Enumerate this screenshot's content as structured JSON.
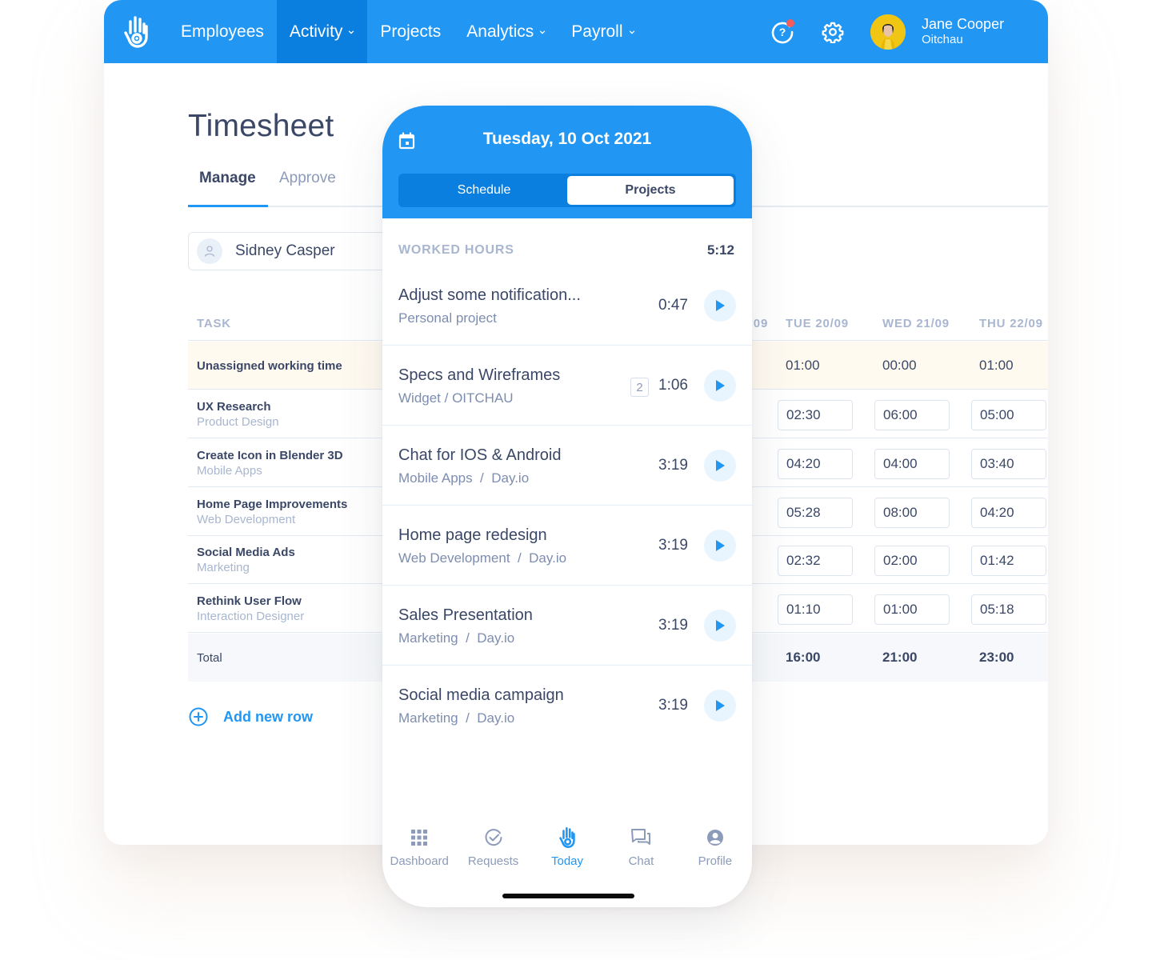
{
  "app": {
    "nav": [
      {
        "label": "Employees",
        "has_dropdown": false,
        "active": false
      },
      {
        "label": "Activity",
        "has_dropdown": true,
        "active": true
      },
      {
        "label": "Projects",
        "has_dropdown": false,
        "active": false
      },
      {
        "label": "Analytics",
        "has_dropdown": true,
        "active": false
      },
      {
        "label": "Payroll",
        "has_dropdown": true,
        "active": false
      }
    ],
    "icons": {
      "logo": "hand-logo-icon",
      "help": "help-icon",
      "settings": "gear-icon"
    },
    "user": {
      "name": "Jane Cooper",
      "org": "Oitchau"
    },
    "colors": {
      "brand": "#2196f3",
      "nav_active": "#0a7fe0",
      "notification": "#f25c5c",
      "text": "#3a4766",
      "muted": "#a8b6cf"
    }
  },
  "timesheet": {
    "title": "Timesheet",
    "tabs": [
      {
        "label": "Manage",
        "active": true
      },
      {
        "label": "Approve",
        "active": false
      }
    ],
    "employee": "Sidney Casper",
    "task_header": "TASK",
    "day_headers": [
      "…09",
      "TUE 20/09",
      "WED 21/09",
      "THU 22/09"
    ],
    "rows": [
      {
        "name": "Unassigned working time",
        "sub": "",
        "values": [
          "01:00",
          "00:00",
          "01:00"
        ]
      },
      {
        "name": "UX Research",
        "sub": "Product Design",
        "values": [
          "02:30",
          "06:00",
          "05:00"
        ]
      },
      {
        "name": "Create Icon in Blender 3D",
        "sub": "Mobile Apps",
        "values": [
          "04:20",
          "04:00",
          "03:40"
        ]
      },
      {
        "name": "Home Page Improvements",
        "sub": "Web Development",
        "values": [
          "05:28",
          "08:00",
          "04:20"
        ]
      },
      {
        "name": "Social Media Ads",
        "sub": "Marketing",
        "values": [
          "02:32",
          "02:00",
          "01:42"
        ]
      },
      {
        "name": "Rethink User Flow",
        "sub": "Interaction Designer",
        "values": [
          "01:10",
          "01:00",
          "05:18"
        ]
      }
    ],
    "total": {
      "label": "Total",
      "values": [
        "16:00",
        "21:00",
        "23:00"
      ]
    },
    "add_row_label": "Add new row"
  },
  "phone": {
    "date": "Tuesday, 10 Oct 2021",
    "segments": [
      {
        "label": "Schedule",
        "active": false
      },
      {
        "label": "Projects",
        "active": true
      }
    ],
    "worked_label": "WORKED HOURS",
    "worked_total": "5:12",
    "items": [
      {
        "title": "Adjust some notification...",
        "sub": "Personal project",
        "time": "0:47",
        "badge": ""
      },
      {
        "title": "Specs and Wireframes",
        "sub": "Widget / OITCHAU",
        "time": "1:06",
        "badge": "2"
      },
      {
        "title": "Chat for IOS & Android",
        "sub": "Mobile Apps  /  Day.io",
        "time": "3:19",
        "badge": ""
      },
      {
        "title": "Home page redesign",
        "sub": "Web Development  /  Day.io",
        "time": "3:19",
        "badge": ""
      },
      {
        "title": "Sales Presentation",
        "sub": "Marketing  /  Day.io",
        "time": "3:19",
        "badge": ""
      },
      {
        "title": "Social media campaign",
        "sub": "Marketing  /  Day.io",
        "time": "3:19",
        "badge": ""
      }
    ],
    "tabbar": [
      {
        "label": "Dashboard",
        "icon": "grid-icon",
        "active": false
      },
      {
        "label": "Requests",
        "icon": "check-circle-icon",
        "active": false
      },
      {
        "label": "Today",
        "icon": "hand-logo-icon",
        "active": true
      },
      {
        "label": "Chat",
        "icon": "chat-icon",
        "active": false
      },
      {
        "label": "Profile",
        "icon": "profile-icon",
        "active": false
      }
    ]
  }
}
